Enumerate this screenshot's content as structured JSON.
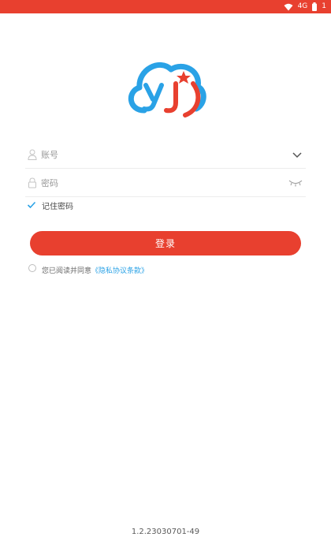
{
  "status_bar": {
    "color": "#e8402f",
    "icons": [
      "wifi-icon",
      "signal-icon",
      "battery-icon"
    ],
    "signal_text": "4G",
    "battery_text": "1"
  },
  "logo": {
    "icon": "cloud-yj-logo",
    "colors": [
      "#2aa2e6",
      "#e8402f"
    ]
  },
  "form": {
    "account_placeholder": "账号",
    "password_placeholder": "密码",
    "remember_label": "记住密码",
    "remember_checked": true
  },
  "login_button": {
    "label": "登录",
    "color": "#e8402f"
  },
  "agreement": {
    "text": "您已阅读并同意",
    "link_text": "《隐私协议条款》",
    "link_color": "#2aa2e6"
  },
  "version": "1.2.23030701-49"
}
